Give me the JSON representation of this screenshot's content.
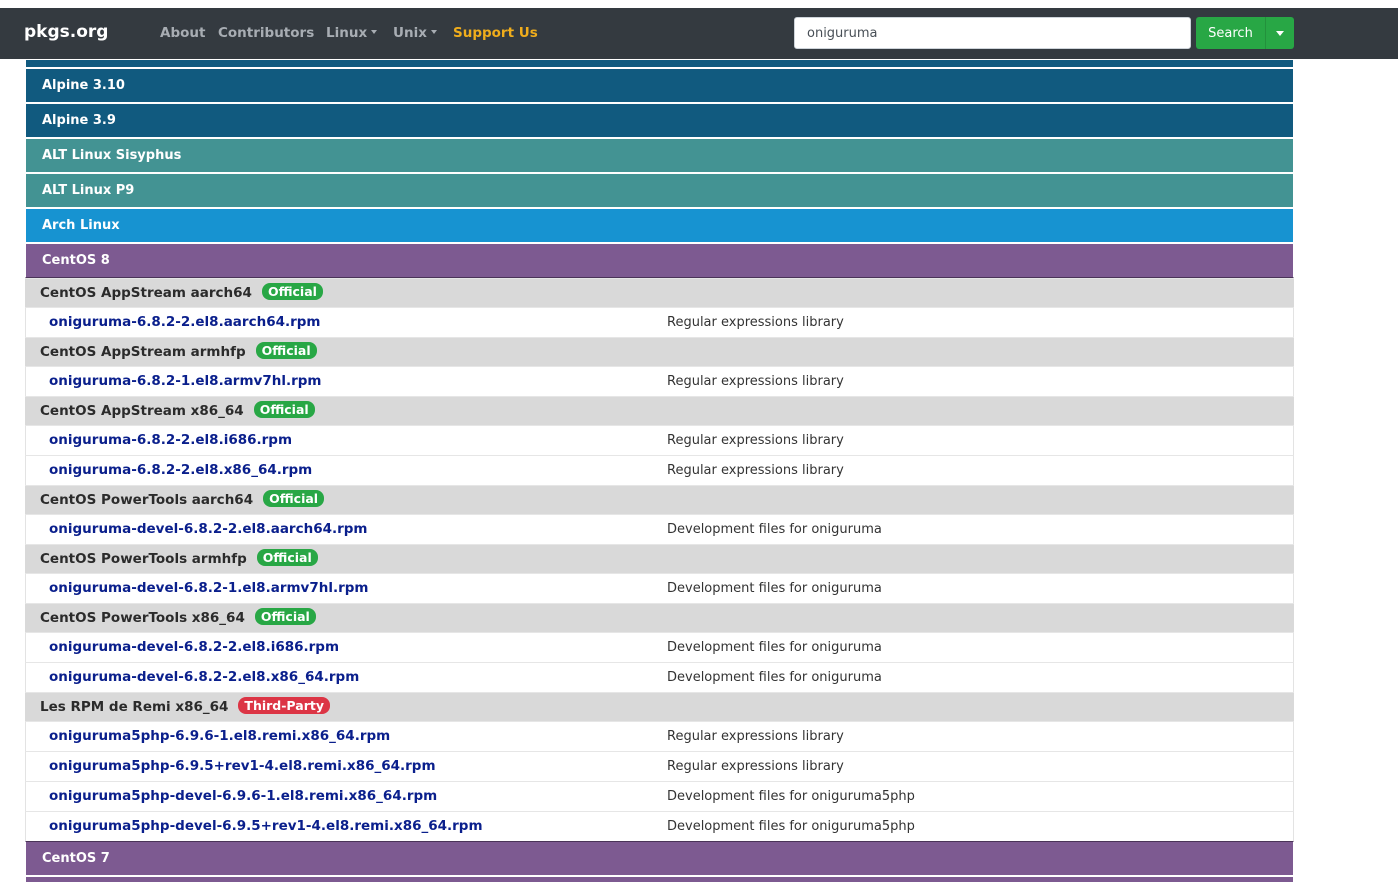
{
  "nav": {
    "brand": "pkgs.org",
    "links": [
      {
        "label": "About"
      },
      {
        "label": "Contributors"
      },
      {
        "label": "Linux"
      },
      {
        "label": "Unix"
      },
      {
        "label": "Support Us"
      }
    ],
    "search_value": "oniguruma",
    "search_button": "Search"
  },
  "colors": {
    "alpine": "#115a7f",
    "altlinux": "#439393",
    "arch": "#1793d1",
    "centos": "#7d5a91",
    "official": "#28a745",
    "third_party": "#dc3545",
    "support_link": "#f0ad1c"
  },
  "distros_above": [
    {
      "name": "Alpine 3.10"
    },
    {
      "name": "Alpine 3.9"
    },
    {
      "name": "ALT Linux Sisyphus"
    },
    {
      "name": "ALT Linux P9"
    },
    {
      "name": "Arch Linux"
    }
  ],
  "centos8": {
    "name": "CentOS 8",
    "repos": [
      {
        "name": "CentOS AppStream aarch64",
        "badge": "Official",
        "packages": [
          {
            "file": "oniguruma-6.8.2-2.el8.aarch64.rpm",
            "desc": "Regular expressions library"
          }
        ]
      },
      {
        "name": "CentOS AppStream armhfp",
        "badge": "Official",
        "packages": [
          {
            "file": "oniguruma-6.8.2-1.el8.armv7hl.rpm",
            "desc": "Regular expressions library"
          }
        ]
      },
      {
        "name": "CentOS AppStream x86_64",
        "badge": "Official",
        "packages": [
          {
            "file": "oniguruma-6.8.2-2.el8.i686.rpm",
            "desc": "Regular expressions library"
          },
          {
            "file": "oniguruma-6.8.2-2.el8.x86_64.rpm",
            "desc": "Regular expressions library"
          }
        ]
      },
      {
        "name": "CentOS PowerTools aarch64",
        "badge": "Official",
        "packages": [
          {
            "file": "oniguruma-devel-6.8.2-2.el8.aarch64.rpm",
            "desc": "Development files for oniguruma"
          }
        ]
      },
      {
        "name": "CentOS PowerTools armhfp",
        "badge": "Official",
        "packages": [
          {
            "file": "oniguruma-devel-6.8.2-1.el8.armv7hl.rpm",
            "desc": "Development files for oniguruma"
          }
        ]
      },
      {
        "name": "CentOS PowerTools x86_64",
        "badge": "Official",
        "packages": [
          {
            "file": "oniguruma-devel-6.8.2-2.el8.i686.rpm",
            "desc": "Development files for oniguruma"
          },
          {
            "file": "oniguruma-devel-6.8.2-2.el8.x86_64.rpm",
            "desc": "Development files for oniguruma"
          }
        ]
      },
      {
        "name": "Les RPM de Remi x86_64",
        "badge": "Third-Party",
        "packages": [
          {
            "file": "oniguruma5php-6.9.6-1.el8.remi.x86_64.rpm",
            "desc": "Regular expressions library"
          },
          {
            "file": "oniguruma5php-6.9.5+rev1-4.el8.remi.x86_64.rpm",
            "desc": "Regular expressions library"
          },
          {
            "file": "oniguruma5php-devel-6.9.6-1.el8.remi.x86_64.rpm",
            "desc": "Development files for oniguruma5php"
          },
          {
            "file": "oniguruma5php-devel-6.9.5+rev1-4.el8.remi.x86_64.rpm",
            "desc": "Development files for oniguruma5php"
          }
        ]
      }
    ]
  },
  "distros_below": [
    {
      "name": "CentOS 7"
    }
  ]
}
